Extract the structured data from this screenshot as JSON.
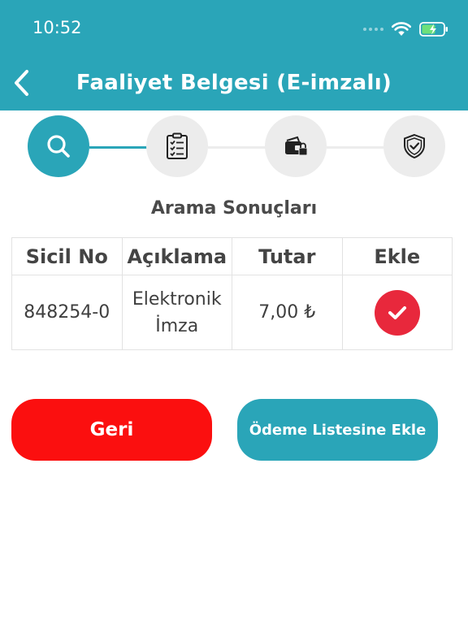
{
  "status_bar": {
    "time": "10:52"
  },
  "header": {
    "title": "Faaliyet Belgesi (E-imzalı)",
    "color": "#2aa5b8"
  },
  "stepper": {
    "steps": [
      {
        "icon": "search-icon",
        "active": true
      },
      {
        "icon": "clipboard-checklist-icon",
        "active": false
      },
      {
        "icon": "wallet-card-icon",
        "active": false
      },
      {
        "icon": "shield-check-icon",
        "active": false
      }
    ]
  },
  "results": {
    "title": "Arama Sonuçları",
    "columns": [
      "Sicil No",
      "Açıklama",
      "Tutar",
      "Ekle"
    ],
    "rows": [
      {
        "sicil_no": "848254-0",
        "aciklama_line1": "Elektronik",
        "aciklama_line2": "İmza",
        "tutar": "7,00 ₺",
        "ekle_selected": true
      }
    ]
  },
  "buttons": {
    "back_label": "Geri",
    "add_label": "Ödeme Listesine Ekle",
    "back_color": "#fb0f0f",
    "add_color": "#2aa5b8"
  }
}
